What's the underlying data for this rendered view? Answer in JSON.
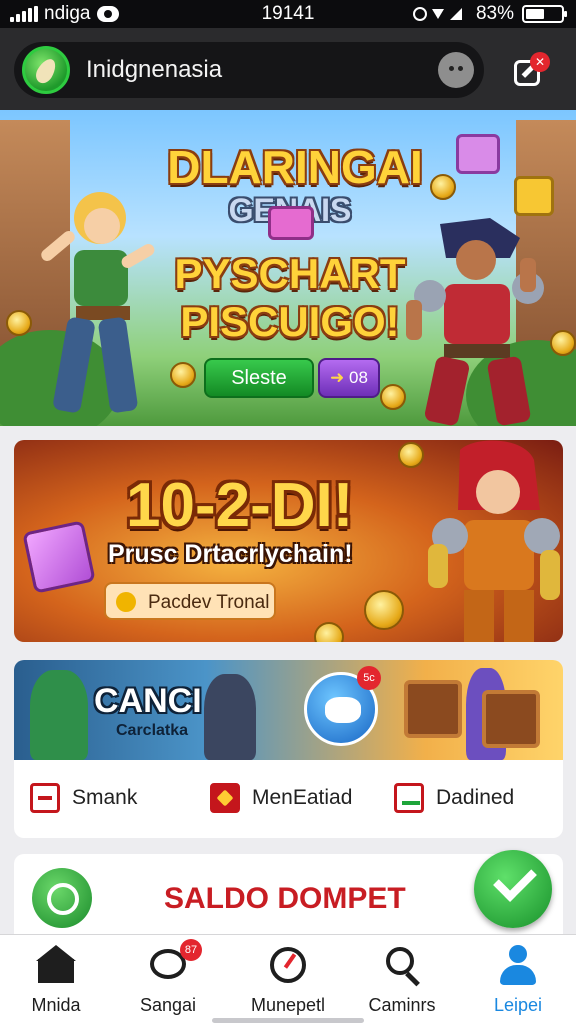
{
  "status_bar": {
    "carrier": "ndiga",
    "time": "19141",
    "battery": "83%"
  },
  "header": {
    "app_name": "Inidgnenasia",
    "edit_badge": "✕"
  },
  "hero": {
    "title_line1": "DLARINGAI",
    "title_line2": "GENAIS",
    "title_line3": "PYSCHART",
    "title_line4": "PISCUIGO!",
    "primary_button": "Sleste",
    "secondary_button": "08"
  },
  "banner2": {
    "title": "10-2-DI!",
    "subtitle": "Prusc Drtacrlychain!",
    "button": "Pacdev Tronal"
  },
  "banner3": {
    "title": "CANCI",
    "subtitle": "Carclatka",
    "badge": "5c"
  },
  "quick_actions": [
    {
      "label": "Smank",
      "icon": "tag-icon"
    },
    {
      "label": "MenEatiad",
      "icon": "star-badge-icon"
    },
    {
      "label": "Dadined",
      "icon": "flag-icon"
    }
  ],
  "saldo": {
    "label": "SALDO DOMPET"
  },
  "bottom_nav": {
    "items": [
      {
        "label": "Mnida",
        "icon": "home-icon"
      },
      {
        "label": "Sangai",
        "icon": "chat-icon",
        "badge": "87"
      },
      {
        "label": "Munepetl",
        "icon": "dial-icon"
      },
      {
        "label": "Caminrs",
        "icon": "search-icon"
      },
      {
        "label": "Leipei",
        "icon": "profile-icon"
      }
    ]
  },
  "colors": {
    "accent_blue": "#1a88e0",
    "saldo_red": "#c81d23",
    "confirm_green": "#17902a"
  }
}
